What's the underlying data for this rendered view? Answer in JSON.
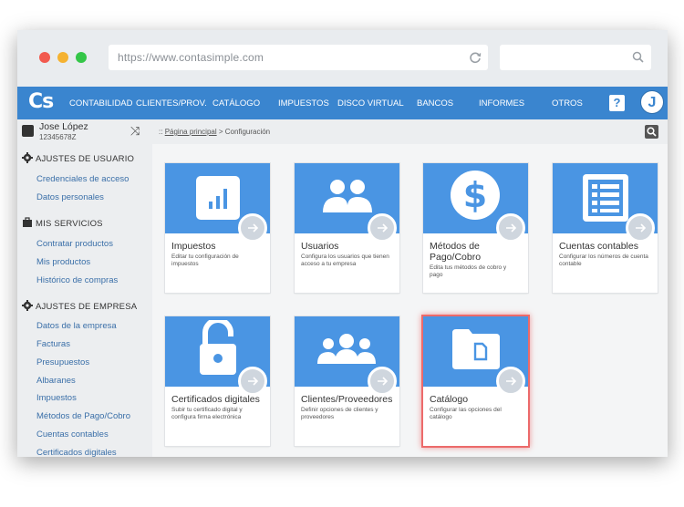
{
  "browser": {
    "url": "https://www.contasimple.com"
  },
  "header": {
    "logo": "Cs",
    "nav": [
      "CONTABILIDAD",
      "CLIENTES/PROV.",
      "CATÁLOGO",
      "IMPUESTOS",
      "DISCO VIRTUAL",
      "BANCOS",
      "INFORMES",
      "OTROS"
    ],
    "help_label": "?",
    "avatar_initial": "J"
  },
  "user": {
    "name": "Jose López",
    "id": "12345678Z"
  },
  "sidebar": {
    "sections": [
      {
        "title": "AJUSTES DE USUARIO",
        "items": [
          "Credenciales de acceso",
          "Datos personales"
        ]
      },
      {
        "title": "MIS SERVICIOS",
        "items": [
          "Contratar productos",
          "Mis productos",
          "Histórico de compras"
        ]
      },
      {
        "title": "AJUSTES DE EMPRESA",
        "items": [
          "Datos de la empresa",
          "Facturas",
          "Presupuestos",
          "Albaranes",
          "Impuestos",
          "Métodos de Pago/Cobro",
          "Cuentas contables",
          "Certificados digitales"
        ]
      }
    ]
  },
  "breadcrumb": {
    "prefix": "::",
    "home": "Página principal",
    "separator": ">",
    "current": "Configuración"
  },
  "cards": [
    {
      "title": "Impuestos",
      "desc": "Editar tu configuración de impuestos",
      "icon": "bar-chart-icon"
    },
    {
      "title": "Usuarios",
      "desc": "Configura los usuarios que tienen acceso a tu empresa",
      "icon": "users-icon"
    },
    {
      "title": "Métodos de Pago/Cobro",
      "desc": "Edita tus métodos de cobro y pago",
      "icon": "dollar-icon"
    },
    {
      "title": "Cuentas contables",
      "desc": "Configurar los números de cuenta contable",
      "icon": "ledger-icon"
    },
    {
      "title": "Certificados digitales",
      "desc": "Subir tu certificado digital y configura firma electrónica",
      "icon": "padlock-icon"
    },
    {
      "title": "Clientes/Proveedores",
      "desc": "Definir opciones de clientes y proveedores",
      "icon": "group-icon"
    },
    {
      "title": "Catálogo",
      "desc": "Configurar las opciones del catálogo",
      "icon": "folder-icon"
    }
  ],
  "colors": {
    "brand": "#3a85cf",
    "card_top": "#4a95e3",
    "highlight": "#ec6a6a"
  }
}
